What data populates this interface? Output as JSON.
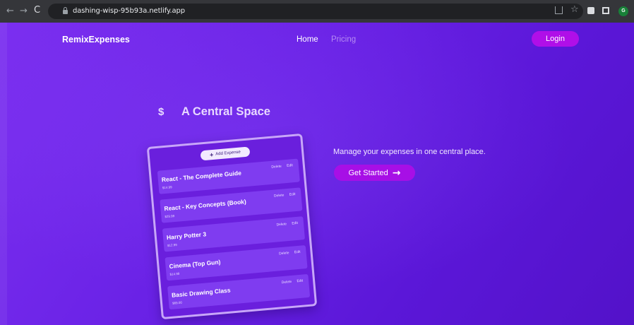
{
  "browser": {
    "url": "dashing-wisp-95b93a.netlify.app",
    "profile_initial": "G"
  },
  "header": {
    "brand": "RemixExpenses",
    "nav": [
      {
        "label": "Home"
      },
      {
        "label": "Pricing"
      }
    ],
    "login_label": "Login"
  },
  "hero": {
    "dollar": "$",
    "title": "A Central Space",
    "tagline": "Manage your expenses in one central place.",
    "cta_label": "Get Started"
  },
  "card": {
    "add_label": "Add Expense",
    "delete_label": "Delete",
    "edit_label": "Edit",
    "expenses": [
      {
        "title": "React - The Complete Guide",
        "amount": "$14.99"
      },
      {
        "title": "React - Key Concepts (Book)",
        "amount": "$29.99"
      },
      {
        "title": "Harry Potter 3",
        "amount": "$12.99"
      },
      {
        "title": "Cinema (Top Gun)",
        "amount": "$14.99"
      },
      {
        "title": "Basic Drawing Class",
        "amount": "$69.00"
      }
    ]
  },
  "colors": {
    "bg_start": "#7b2ff0",
    "bg_end": "#5312c9",
    "button": "#b00fe8",
    "nav_inactive": "#b58bf3"
  }
}
